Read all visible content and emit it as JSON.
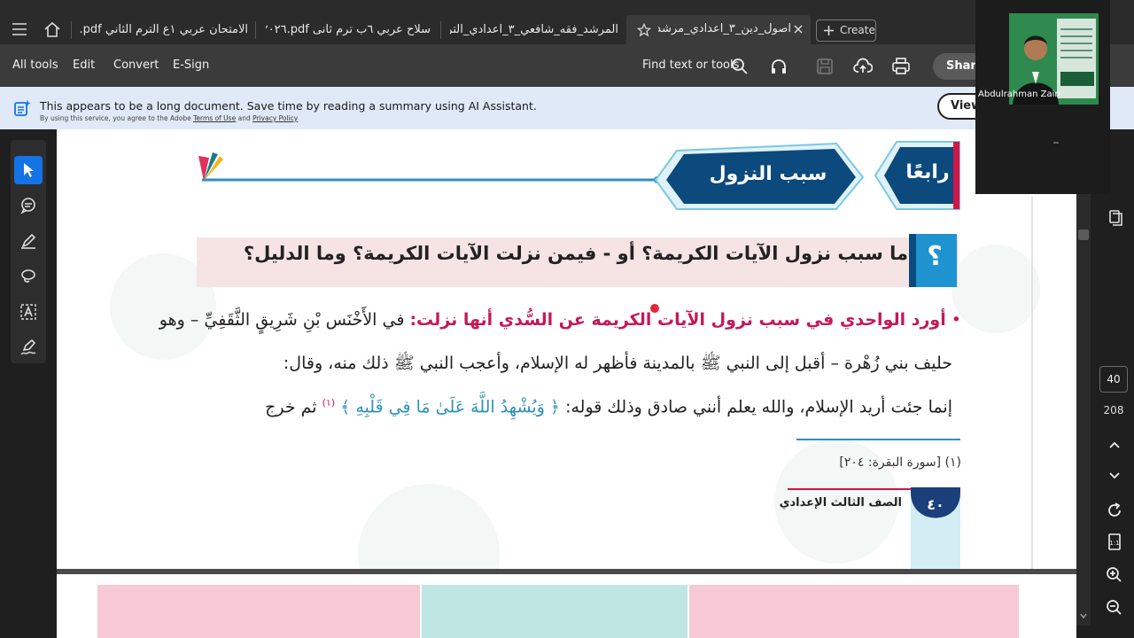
{
  "tabs": [
    {
      "label": "الامتحان عربي ١ع الترم الثاني pdf.٢٠٢٦",
      "active": false
    },
    {
      "label": "سلاح عربي ٦ب ترم ثانى pdf.٢٠٢٦",
      "active": false
    },
    {
      "label": "المرشد_فقه_شافعي_٣_اعدادي_الترم_ا...",
      "active": false
    },
    {
      "label": "اصول_دين_٣_اعدادي_مرشد...",
      "active": true
    }
  ],
  "create_label": "Create",
  "toolbar": {
    "menus": [
      "All tools",
      "Edit",
      "Convert",
      "E-Sign"
    ],
    "find_label": "Find text or tools",
    "share_label": "Share"
  },
  "banner": {
    "message": "This appears to be a long document. Save time by reading a summary using AI Assistant.",
    "legal_prefix": "By using this service, you agree to the Adobe",
    "terms_label": "Terms of Use",
    "and": "and",
    "privacy_label": "Privacy Policy",
    "view_label": "View"
  },
  "document": {
    "section_badge": "رابعًا",
    "section_title": "سبب النزول",
    "question": "ما سبب نزول الآيات الكريمة؟ أو - فيمن نزلت الآيات الكريمة؟ وما الدليل؟",
    "question_mark": "؟",
    "para_highlight": "أورد الواحدي في سبب نزول الآيات الكريمة عن السُّدي أنها نزلت:",
    "para_line1_rest": "في الأَخْنَس بْنِ شَرِيقٍ الثَّقَفِيِّ – وهو",
    "para_line2": "حليف بني زُهْرة – أقبل إلى النبي ﷺ بالمدينة فأظهر له الإسلام، وأعجب النبي ﷺ ذلك منه، وقال:",
    "para_line3_start": "إنما جئت أريد الإسلام، والله يعلم أنني صادق وذلك قوله:",
    "quran_verse": "﴿ وَيُشْهِدُ اللَّهَ عَلَىٰ مَا فِي قَلْبِهِ ﴾",
    "footnote_mark": "(١)",
    "para_line3_end": "ثم خرج",
    "footnote": "(١) [سورة البقرة: ٢٠٤]",
    "grade_label": "الصف الثالث الإعدادي",
    "page_badge": "٤٠"
  },
  "navigation": {
    "current_page": "40",
    "page_count": "208"
  },
  "webcam": {
    "name": "Abdulrahman Zain"
  },
  "colors": {
    "accent_blue": "#1473e6",
    "title_navy": "#0c4a7d",
    "highlight_magenta": "#c4185a",
    "badge_red": "#d3164a",
    "quran_teal": "#2f90b8"
  }
}
